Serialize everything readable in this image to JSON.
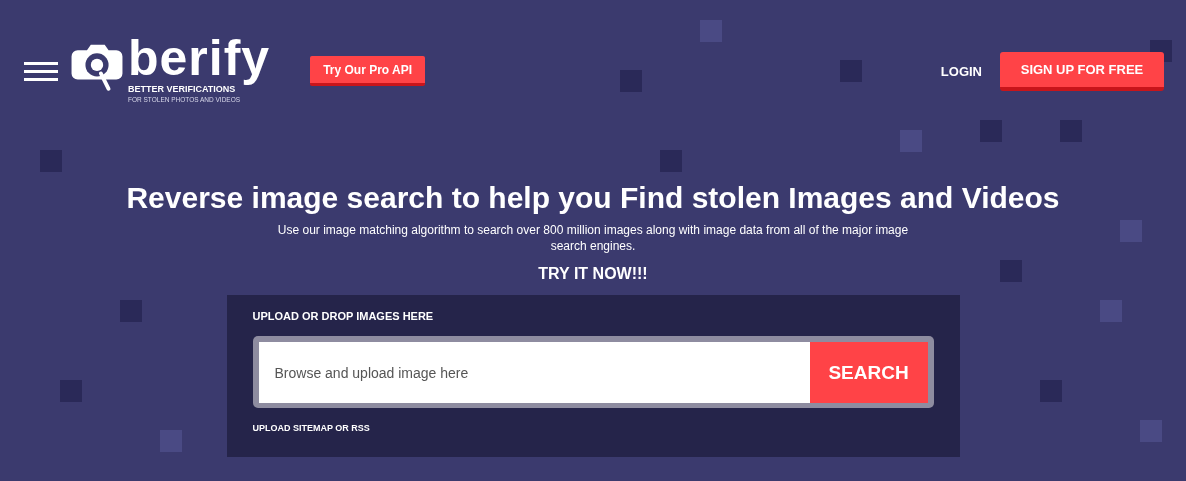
{
  "header": {
    "logo": {
      "name": "berify",
      "tagline": "BETTER VERIFICATIONS",
      "subtagline": "FOR STOLEN PHOTOS AND VIDEOS"
    },
    "api_button": "Try Our Pro API",
    "login": "LOGIN",
    "signup_button": "SIGN UP FOR FREE"
  },
  "hero": {
    "title": "Reverse image search to help you Find stolen Images and Videos",
    "subtitle": "Use our image matching algorithm to search over 800 million images along with image data from all of the major image search engines.",
    "cta": "TRY IT NOW!!!"
  },
  "upload_panel": {
    "label": "UPLOAD OR DROP IMAGES HERE",
    "field": {
      "placeholder": "Browse and upload image here"
    },
    "search_button": "SEARCH",
    "sitemap_link": "UPLOAD SITEMAP OR RSS"
  }
}
